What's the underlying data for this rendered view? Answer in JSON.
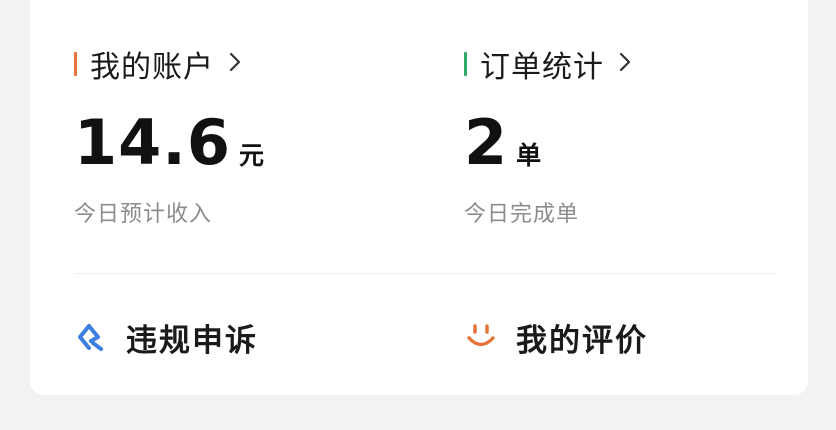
{
  "colors": {
    "account_accent": "#e5743a",
    "orders_accent": "#2fa66a",
    "complaint_icon": "#3d7fe0",
    "review_icon": "#e5743a"
  },
  "account": {
    "title": "我的账户",
    "value": "14.6",
    "unit": "元",
    "caption": "今日预计收入"
  },
  "orders": {
    "title": "订单统计",
    "value": "2",
    "unit": "单",
    "caption": "今日完成单"
  },
  "actions": [
    {
      "label": "违规申诉",
      "icon": "appeal-icon"
    },
    {
      "label": "我的评价",
      "icon": "smile-icon"
    }
  ]
}
